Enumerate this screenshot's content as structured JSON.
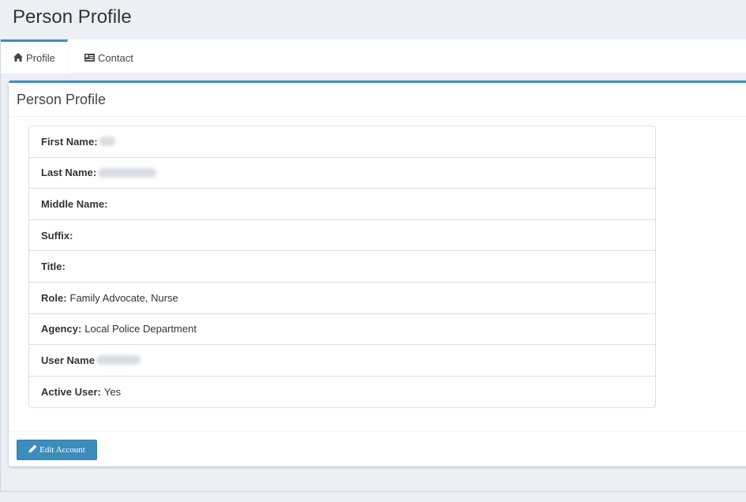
{
  "page": {
    "title": "Person Profile"
  },
  "tabs": [
    {
      "label": "Profile",
      "icon": "home-icon",
      "active": true
    },
    {
      "label": "Contact",
      "icon": "contact-card-icon",
      "active": false
    }
  ],
  "box": {
    "title": "Person Profile",
    "fields": [
      {
        "label": "First Name:",
        "value": "",
        "redacted": true
      },
      {
        "label": "Last Name:",
        "value": "",
        "redacted": true
      },
      {
        "label": "Middle Name:",
        "value": ""
      },
      {
        "label": "Suffix:",
        "value": ""
      },
      {
        "label": "Title:",
        "value": ""
      },
      {
        "label": "Role:",
        "value": "Family Advocate, Nurse"
      },
      {
        "label": "Agency:",
        "value": "Local Police Department"
      },
      {
        "label": "User Name",
        "value": "",
        "redacted": true
      },
      {
        "label": "Active User:",
        "value": "Yes"
      }
    ],
    "edit_button_label": "Edit Account"
  },
  "colors": {
    "accent": "#3c8dbc",
    "background": "#ecf0f5",
    "panel": "#ffffff",
    "border": "#dddddd"
  }
}
